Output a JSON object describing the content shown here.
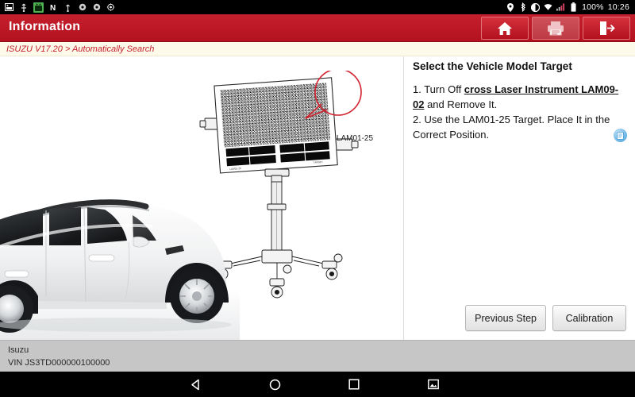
{
  "statusbar": {
    "icons_left": [
      "image-icon",
      "usb-icon",
      "android-icon",
      "n-icon",
      "usb-device-icon",
      "settings-small-icon",
      "settings-small-icon-2",
      "bug-icon"
    ],
    "icons_right": [
      "location-icon",
      "bluetooth-icon",
      "do-not-disturb-icon",
      "wifi-icon",
      "signal-icon",
      "battery-icon"
    ],
    "battery_percent": "100%",
    "clock": "10:26"
  },
  "titlebar": {
    "title": "Information",
    "buttons": [
      {
        "name": "home-button",
        "icon": "home-icon"
      },
      {
        "name": "print-button",
        "icon": "printer-icon"
      },
      {
        "name": "exit-button",
        "icon": "exit-icon"
      }
    ]
  },
  "breadcrumb": {
    "text": "ISUZU V17.20 > Automatically Search"
  },
  "illustration": {
    "callout_label": "LAM01-25",
    "alt_car": "white SUV side view",
    "alt_board": "calibration target board on wheeled stand"
  },
  "panel": {
    "title": "Select the Vehicle Model Target",
    "step1_prefix": "1. Turn Off ",
    "step1_bold": "cross Laser Instrument LAM09-02",
    "step1_suffix": " and Remove It.",
    "step2": "2. Use the LAM01-25 Target. Place It in the Correct Position.",
    "badge_icon": "document-icon"
  },
  "actions": {
    "previous_step": "Previous Step",
    "calibration": "Calibration"
  },
  "footer": {
    "make": "Isuzu",
    "vin": "VIN JS3TD000000100000"
  },
  "navbar": {
    "back": "back-icon",
    "home": "home-circle-icon",
    "recents": "recents-square-icon",
    "screenshot": "screenshot-icon"
  },
  "colors": {
    "accent_red": "#c41f2c",
    "header_red_dark": "#b4121f",
    "breadcrumb_bg": "#fdfae9",
    "footer_bg": "#c6c6c6",
    "badge_blue": "#4a9fd8"
  }
}
